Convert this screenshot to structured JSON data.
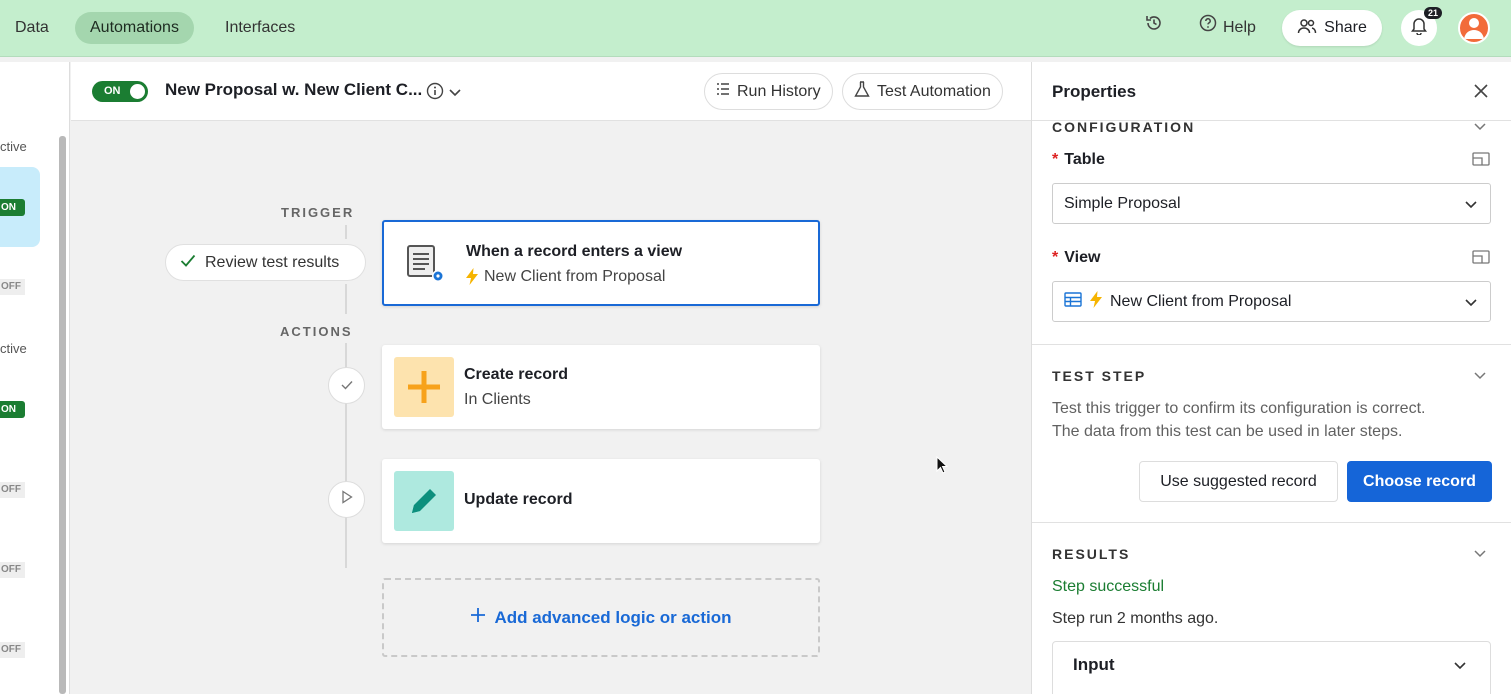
{
  "topbar": {
    "tabs": [
      {
        "label": "Data"
      },
      {
        "label": "Automations",
        "active": true
      },
      {
        "label": "Interfaces"
      }
    ],
    "help_label": "Help",
    "share_label": "Share",
    "notifications_count": "21",
    "colors": {
      "bar": "#c4eecd",
      "active_tab": "#a4d6ae",
      "avatar": "#f26b3a"
    }
  },
  "sidebar": {
    "items": [
      {
        "text": "ctive"
      },
      {
        "status": "ON"
      },
      {
        "status": "OFF"
      },
      {
        "text": "ctive"
      },
      {
        "status": "ON"
      },
      {
        "status": "OFF"
      },
      {
        "status": "OFF"
      },
      {
        "status": "OFF"
      }
    ]
  },
  "editor": {
    "toggle_label": "ON",
    "automation_title": "New Proposal w. New Client C...",
    "run_history_label": "Run History",
    "test_automation_label": "Test Automation"
  },
  "canvas": {
    "trigger_label": "TRIGGER",
    "actions_label": "ACTIONS",
    "review_label": "Review test results",
    "trigger_card": {
      "title": "When a record enters a view",
      "subtitle": "New Client from Proposal"
    },
    "actions": [
      {
        "title": "Create record",
        "subtitle": "In Clients",
        "color": "#fde3ae"
      },
      {
        "title": "Update record",
        "subtitle": "",
        "color": "#aee9df"
      }
    ],
    "add_label": "Add advanced logic or action"
  },
  "properties": {
    "title": "Properties",
    "configuration_heading": "CONFIGURATION",
    "table_label": "Table",
    "table_value": "Simple Proposal",
    "view_label": "View",
    "view_value": "New Client from Proposal",
    "test_step_heading": "TEST STEP",
    "test_desc_line1": "Test this trigger to confirm its configuration is correct.",
    "test_desc_line2": "The data from this test can be used in later steps.",
    "use_suggested_label": "Use suggested record",
    "choose_record_label": "Choose record",
    "results_heading": "RESULTS",
    "success_text": "Step successful",
    "run_time_text": "Step run 2 months ago.",
    "input_label": "Input",
    "colors": {
      "primary": "#1565d8",
      "success": "#1b7d32",
      "required": "#d22"
    }
  }
}
